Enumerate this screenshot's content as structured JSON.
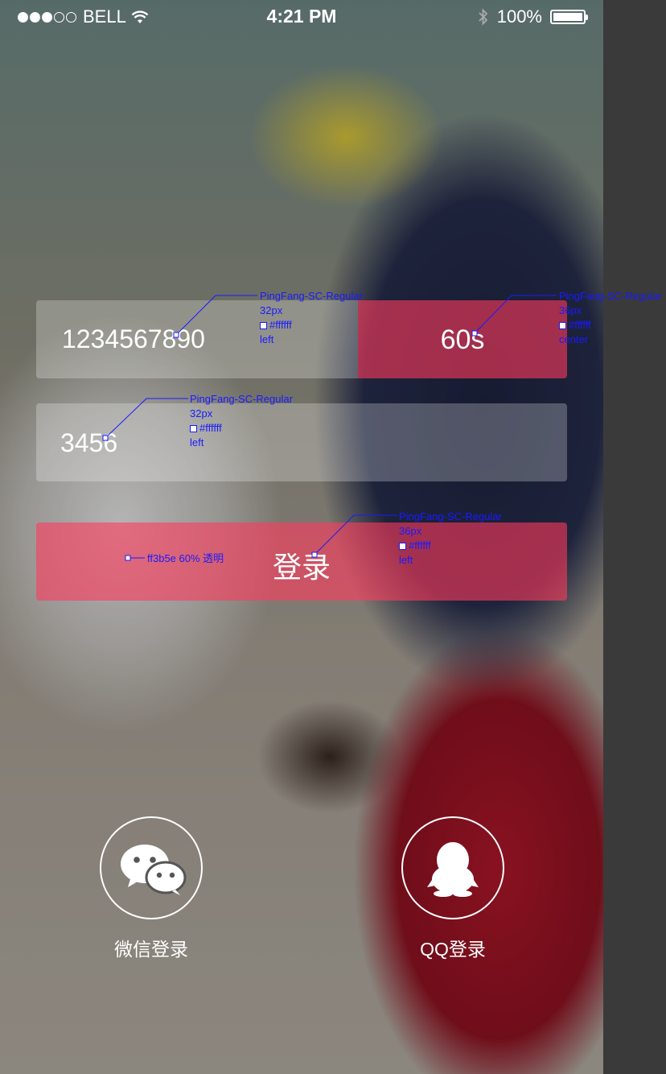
{
  "status_bar": {
    "carrier": "BELL",
    "time": "4:21 PM",
    "battery": "100%"
  },
  "form": {
    "phone_value": "1234567890",
    "countdown_label": "60s",
    "code_value": "3456",
    "login_label": "登录"
  },
  "annotations": {
    "phone": {
      "font": "PingFang-SC-Regular",
      "size": "32px",
      "color": "#ffffff",
      "align": "left"
    },
    "countdown": {
      "font": "PingFang-SC-Regular",
      "size": "36px",
      "color": "#ffffff",
      "align": "center"
    },
    "code": {
      "font": "PingFang-SC-Regular",
      "size": "32px",
      "color": "#ffffff",
      "align": "left"
    },
    "button_fill": "ff3b5e  60% 透明",
    "login": {
      "font": "PingFang-SC-Regular",
      "size": "36px",
      "color": "#ffffff",
      "align": "left"
    }
  },
  "social": {
    "wechat_label": "微信登录",
    "qq_label": "QQ登录"
  },
  "colors": {
    "accent": "#ff3b5e",
    "annotation": "#1a1aff"
  }
}
